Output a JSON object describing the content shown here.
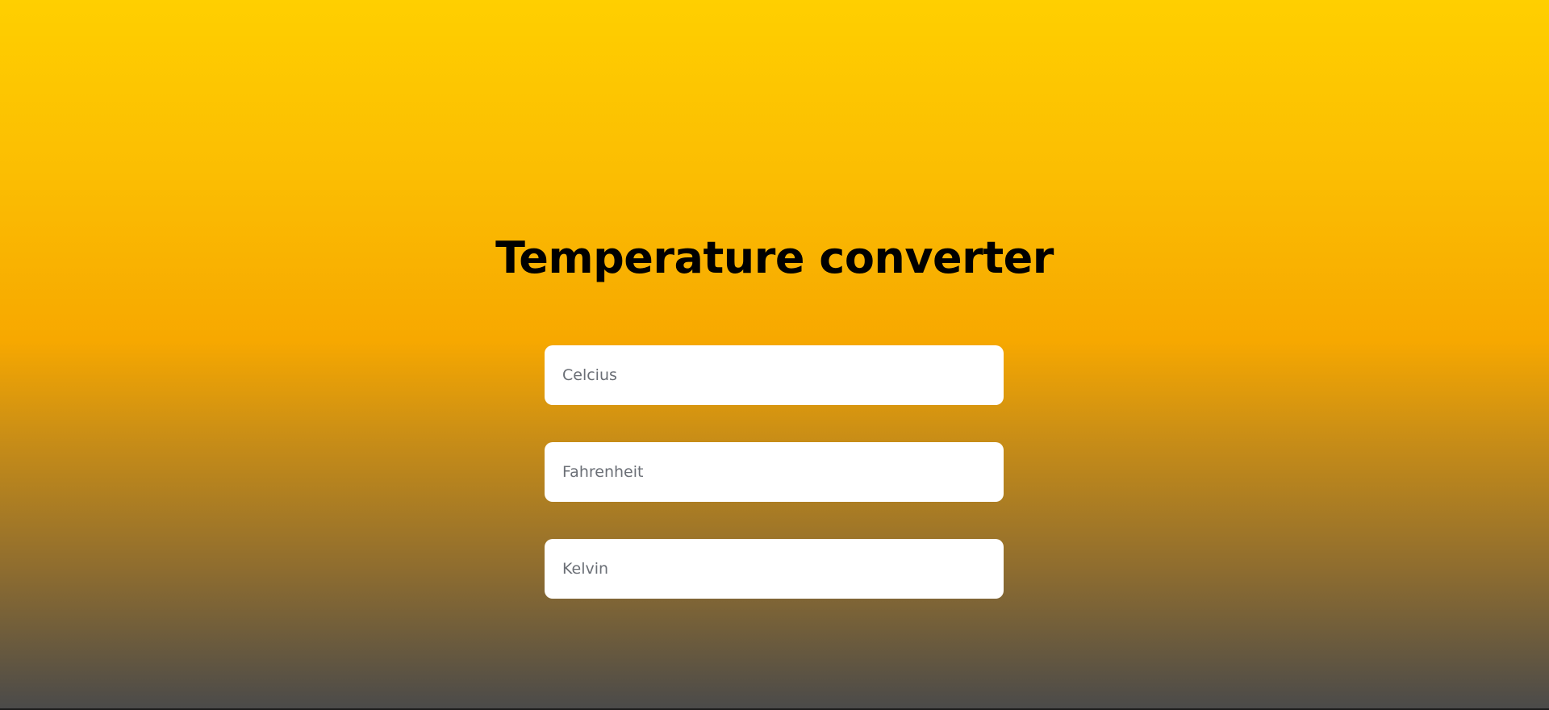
{
  "page": {
    "title": "Temperature converter"
  },
  "fields": [
    {
      "placeholder": "Celcius",
      "value": ""
    },
    {
      "placeholder": "Fahrenheit",
      "value": ""
    },
    {
      "placeholder": "Kelvin",
      "value": ""
    }
  ],
  "colors": {
    "gradient_top": "#ffcf00",
    "gradient_mid": "#f7a800",
    "gradient_bottom": "#4a4a4a",
    "field_background": "#ffffff",
    "title_color": "#000000"
  }
}
